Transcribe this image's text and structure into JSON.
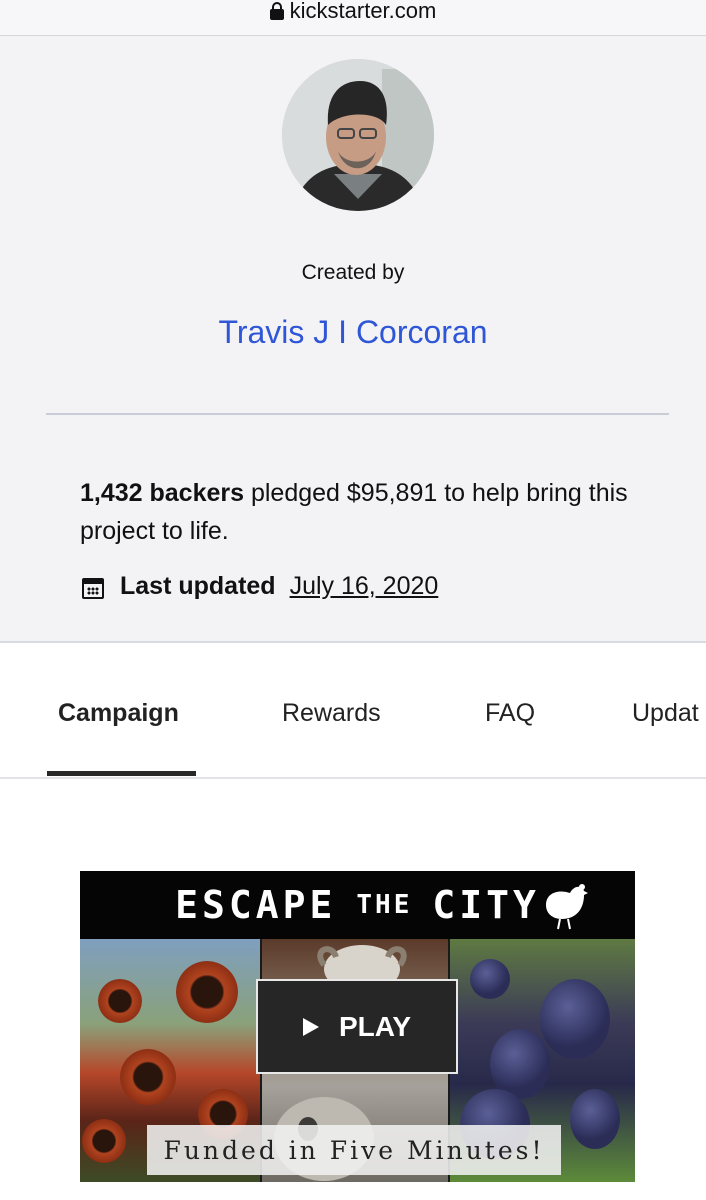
{
  "browser": {
    "url": "kickstarter.com"
  },
  "creator": {
    "created_by_label": "Created by",
    "name": "Travis J I Corcoran",
    "backers": "1,432 backers",
    "pledge_text": " pledged $95,891 to help bring this project to life.",
    "last_updated_label": "Last updated",
    "last_updated_date": "July 16, 2020"
  },
  "tabs": [
    {
      "label": "Campaign",
      "active": true
    },
    {
      "label": "Rewards"
    },
    {
      "label": "FAQ"
    },
    {
      "label": "Updat"
    }
  ],
  "video": {
    "title_main1": "ESCAPE",
    "title_small": "THE",
    "title_main2": "CITY",
    "play_label": "PLAY",
    "caption": "Funded in Five Minutes!"
  },
  "colors": {
    "link": "#2f56d6",
    "creator_bg": "#f3f3f6"
  },
  "icons": [
    "lock-icon",
    "calendar-icon",
    "play-icon",
    "hen-icon"
  ]
}
